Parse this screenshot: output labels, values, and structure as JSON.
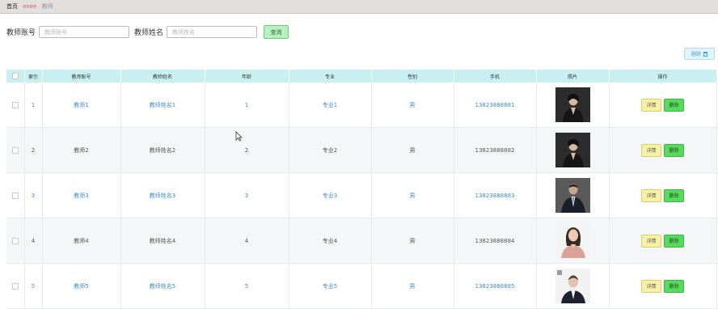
{
  "breadcrumb": {
    "home": "首页",
    "current": "eeee",
    "page": "教师"
  },
  "search": {
    "account_label": "教师账号",
    "account_placeholder": "教师账号",
    "name_label": "教师姓名",
    "name_placeholder": "教师姓名",
    "query_label": "查询"
  },
  "toolbar": {
    "delete_label": "删除"
  },
  "table": {
    "columns": [
      "索引",
      "教师账号",
      "教师姓名",
      "年龄",
      "专业",
      "性别",
      "手机",
      "照片",
      "操作"
    ],
    "rows": [
      {
        "index": "1",
        "account": "教师1",
        "name": "教师姓名1",
        "age": "1",
        "major": "专业1",
        "gender": "男",
        "phone": "13823888881",
        "photo": "teacher-photo-woman-dark-blazer",
        "detail": "详情",
        "delete": "删除"
      },
      {
        "index": "2",
        "account": "教师2",
        "name": "教师姓名2",
        "age": "2",
        "major": "专业2",
        "gender": "男",
        "phone": "13823888882",
        "photo": "teacher-photo-woman-dark-blazer",
        "detail": "详情",
        "delete": "删除"
      },
      {
        "index": "3",
        "account": "教师3",
        "name": "教师姓名3",
        "age": "3",
        "major": "专业3",
        "gender": "男",
        "phone": "13823888883",
        "photo": "teacher-photo-man-dark-suit",
        "detail": "详情",
        "delete": "删除"
      },
      {
        "index": "4",
        "account": "教师4",
        "name": "教师姓名4",
        "age": "4",
        "major": "专业4",
        "gender": "男",
        "phone": "13823888884",
        "photo": "teacher-photo-woman-pink-top",
        "detail": "详情",
        "delete": "删除"
      },
      {
        "index": "5",
        "account": "教师5",
        "name": "教师姓名5",
        "age": "5",
        "major": "专业5",
        "gender": "男",
        "phone": "13823888885",
        "photo": "teacher-photo-man-light-background",
        "detail": "详情",
        "delete": "删除"
      }
    ]
  },
  "colors": {
    "header_bg": "#c9f0f1",
    "link": "#3d8fd4",
    "detail_button": "#f6f1a6",
    "delete_button": "#59d95e",
    "query_button": "#b9f0bf"
  }
}
